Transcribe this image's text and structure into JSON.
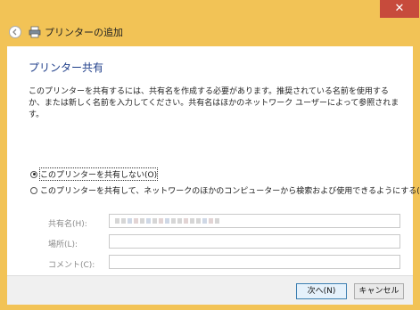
{
  "window": {
    "close_glyph": "✕"
  },
  "header": {
    "title": "プリンターの追加",
    "back_icon": "back-arrow-icon",
    "printer_icon": "printer-icon"
  },
  "main": {
    "section_title": "プリンター共有",
    "description": "このプリンターを共有するには、共有名を作成する必要があります。推奨されている名前を使用するか、または新しく名前を入力してください。共有名はほかのネットワーク ユーザーによって参照されます。",
    "options": [
      {
        "label": "このプリンターを共有しない(O)",
        "selected": true
      },
      {
        "label": "このプリンターを共有して、ネットワークのほかのコンピューターから検索および使用できるようにする(S)",
        "selected": false
      }
    ],
    "fields": [
      {
        "label": "共有名(H):",
        "value": ""
      },
      {
        "label": "場所(L):",
        "value": ""
      },
      {
        "label": "コメント(C):",
        "value": ""
      }
    ]
  },
  "footer": {
    "next_label": "次へ(N)",
    "cancel_label": "キャンセル"
  },
  "colors": {
    "titlebar": "#f2c356",
    "close": "#c74b3c",
    "section_title": "#1f3e8a"
  }
}
